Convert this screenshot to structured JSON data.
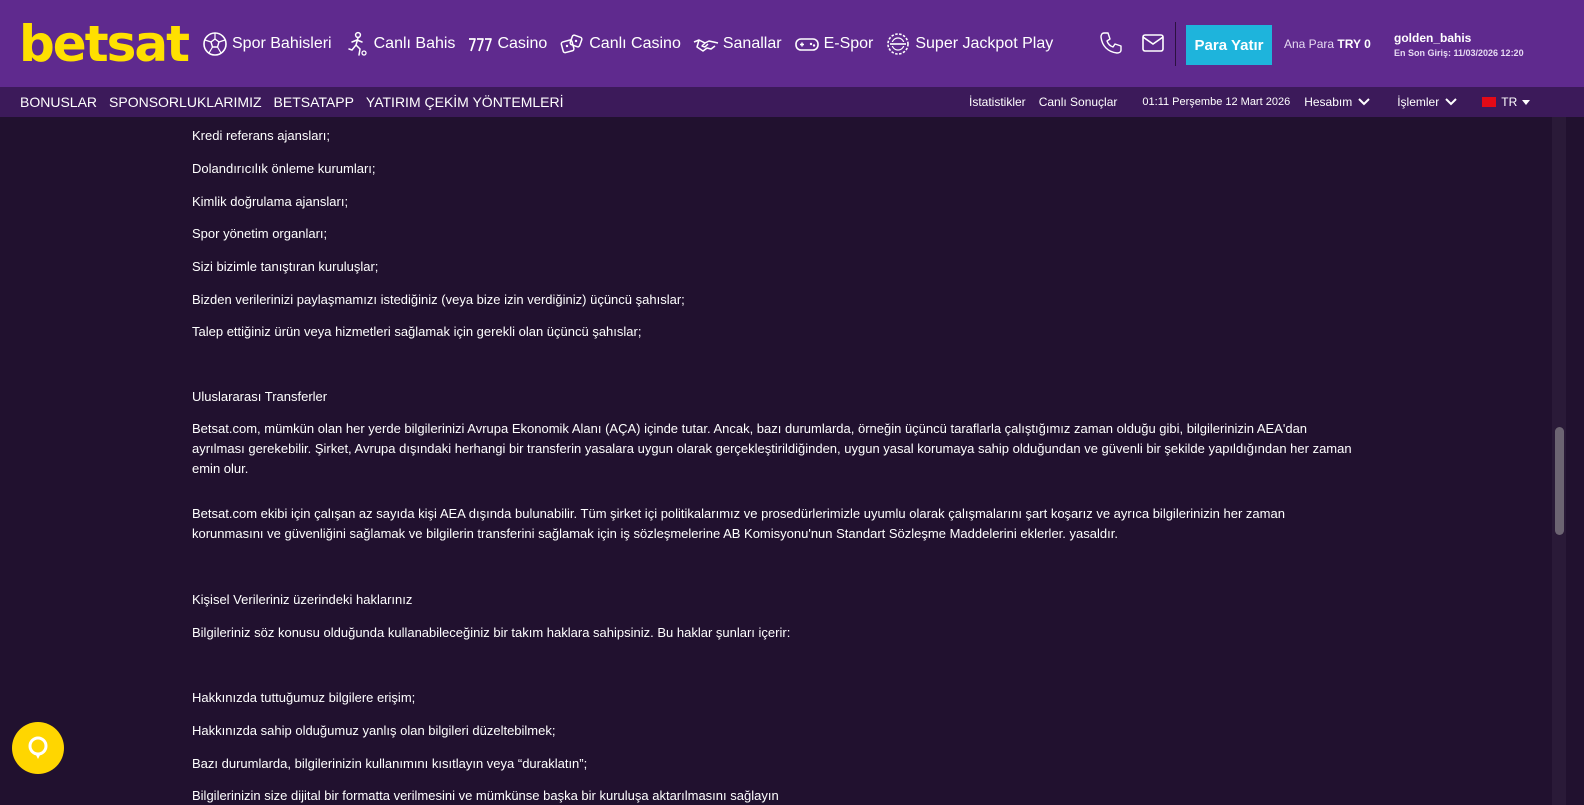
{
  "header": {
    "logo": "betsat",
    "nav": [
      {
        "label": "Spor Bahisleri",
        "icon": "soccer-ball-icon"
      },
      {
        "label": "Canlı Bahis",
        "icon": "player-kick-icon"
      },
      {
        "label": "Casino",
        "icon": "slot-777-icon"
      },
      {
        "label": "Canlı Casino",
        "icon": "dice-icon"
      },
      {
        "label": "Sanallar",
        "icon": "handshake-icon"
      },
      {
        "label": "E-Spor",
        "icon": "gamepad-icon"
      },
      {
        "label": "Super Jackpot Play",
        "icon": "jackpot-icon"
      }
    ],
    "deposit_label": "Para Yatır",
    "balance_label": "Ana Para",
    "balance_value": "TRY 0",
    "username": "golden_bahis",
    "last_login": "En Son Giriş: 11/03/2026 12:20"
  },
  "subnav": {
    "left": [
      "BONUSLAR",
      "SPONSORLUKLARIMIZ",
      "BETSATAPP",
      "YATIRIM ÇEKİM YÖNTEMLERİ"
    ],
    "stats": "İstatistikler",
    "live_results": "Canlı Sonuçlar",
    "datetime": "01:11 Perşembe 12 Mart 2026",
    "account": "Hesabım",
    "transactions": "İşlemler",
    "language": "TR"
  },
  "content": {
    "l1": "Kredi referans ajansları;",
    "l2": "Dolandırıcılık önleme kurumları;",
    "l3": "Kimlik doğrulama ajansları;",
    "l4": "Spor yönetim organları;",
    "l5": "Sizi bizimle tanıştıran kuruluşlar;",
    "l6": "Bizden verilerinizi paylaşmamızı istediğiniz (veya bize izin verdiğiniz) üçüncü şahıslar;",
    "l7": "Talep ettiğiniz ürün veya hizmetleri sağlamak için gerekli olan üçüncü şahıslar;",
    "h1": "Uluslararası Transferler",
    "p1": "Betsat.com, mümkün olan her yerde bilgilerinizi Avrupa Ekonomik Alanı (AÇA) içinde tutar. Ancak, bazı durumlarda, örneğin üçüncü taraflarla çalıştığımız zaman olduğu gibi, bilgilerinizin AEA'dan ayrılması gerekebilir. Şirket, Avrupa dışındaki herhangi bir transferin yasalara uygun olarak gerçekleştirildiğinden, uygun yasal korumaya sahip olduğundan ve güvenli bir şekilde yapıldığından her zaman emin olur.",
    "p2": "Betsat.com ekibi için çalışan az sayıda kişi AEA dışında bulunabilir. Tüm şirket içi politikalarımız ve prosedürlerimizle uyumlu olarak çalışmalarını şart koşarız ve ayrıca bilgilerinizin her zaman korunmasını ve güvenliğini sağlamak ve bilgilerin transferini sağlamak için iş sözleşmelerine AB Komisyonu'nun Standart Sözleşme Maddelerini eklerler. yasaldır.",
    "h2": "Kişisel Verileriniz üzerindeki haklarınız",
    "p3": "Bilgileriniz söz konusu olduğunda kullanabileceğiniz bir takım haklara sahipsiniz. Bu haklar şunları içerir:",
    "l8": "Hakkınızda tuttuğumuz bilgilere erişim;",
    "l9": "Hakkınızda sahip olduğumuz yanlış olan bilgileri düzeltebilmek;",
    "l10": "Bazı durumlarda, bilgilerinizin kullanımını kısıtlayın veya “duraklatın”;",
    "l11": "Bilgilerinizin size dijital bir formatta verilmesini ve mümkünse başka bir kuruluşa aktarılmasını sağlayın"
  },
  "colors": {
    "header_bg": "#5f2a8e",
    "subnav_bg": "#3c1a5a",
    "page_bg": "#21112f",
    "logo": "#ffe000",
    "deposit": "#1eb4dc"
  }
}
